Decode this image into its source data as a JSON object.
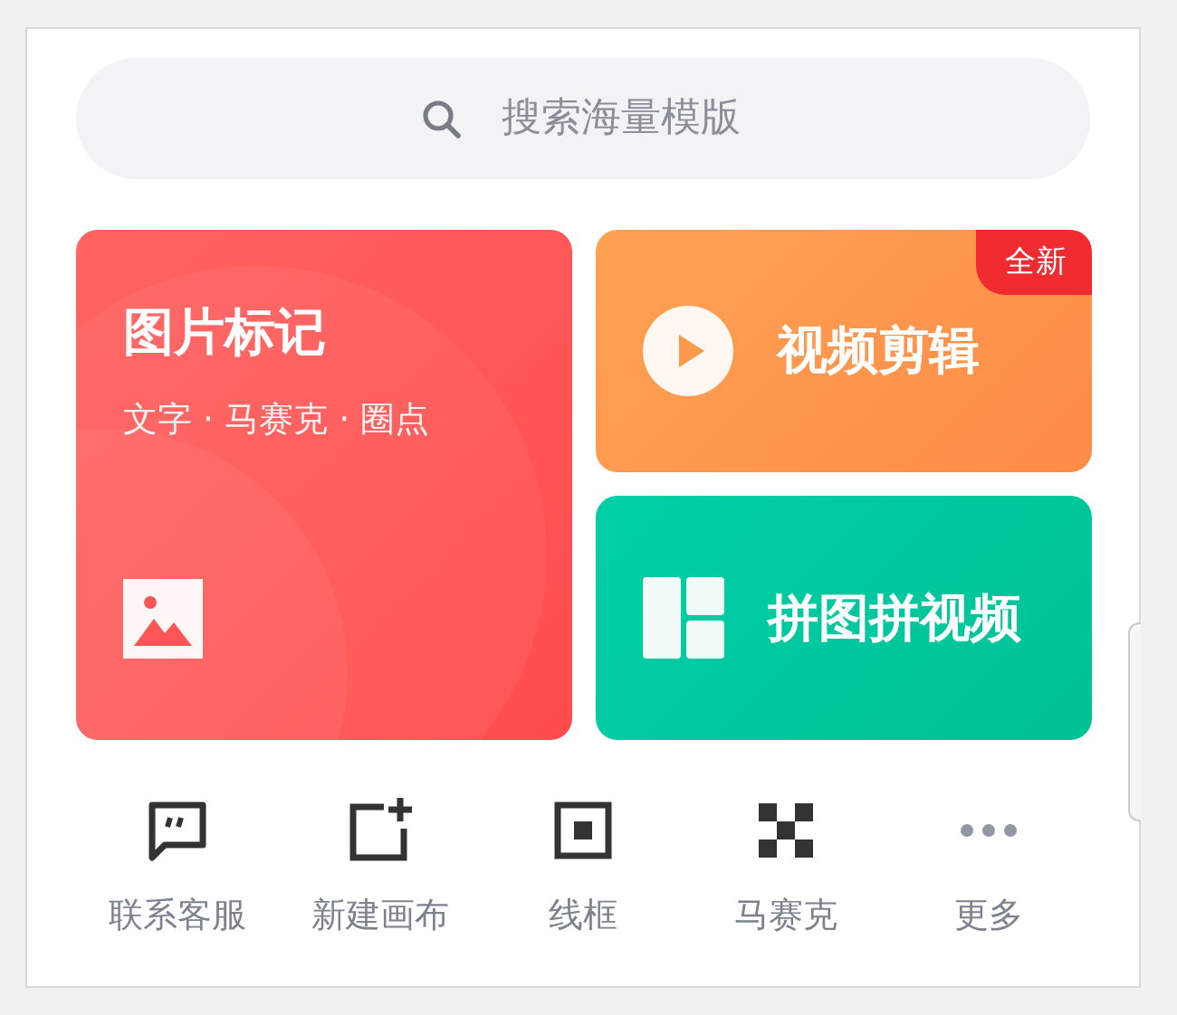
{
  "search": {
    "placeholder": "搜索海量模版"
  },
  "cards": [
    {
      "kind": "mark",
      "title": "图片标记",
      "subtitle": "文字 · 马赛克 · 圈点"
    },
    {
      "kind": "video",
      "title": "视频剪辑",
      "badge": "全新"
    },
    {
      "kind": "collage",
      "title": "拼图拼视频"
    }
  ],
  "tools": [
    {
      "kind": "chat",
      "label": "联系客服"
    },
    {
      "kind": "canvas",
      "label": "新建画布"
    },
    {
      "kind": "frame",
      "label": "线框"
    },
    {
      "kind": "mosaic",
      "label": "马赛克"
    },
    {
      "kind": "more",
      "label": "更多"
    }
  ]
}
